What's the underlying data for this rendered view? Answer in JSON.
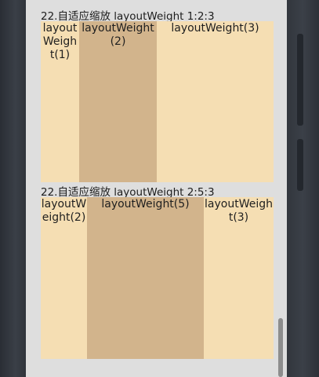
{
  "section1": {
    "title": "22.自适应缩放 layoutWeight 1:2:3",
    "cells": [
      {
        "label": "layoutWeight(1)",
        "weight": 1,
        "color": "#f5deb3"
      },
      {
        "label": "layoutWeight(2)",
        "weight": 2,
        "color": "#d2b48c"
      },
      {
        "label": "layoutWeight(3)",
        "weight": 3,
        "color": "#f5deb3"
      }
    ]
  },
  "section2": {
    "title": "22.自适应缩放 layoutWeight 2:5:3",
    "cells": [
      {
        "label": "layoutWeight(2)",
        "weight": 2,
        "color": "#f5deb3"
      },
      {
        "label": "layoutWeight(5)",
        "weight": 5,
        "color": "#d2b48c"
      },
      {
        "label": "layoutWeight(3)",
        "weight": 3,
        "color": "#f5deb3"
      }
    ]
  }
}
